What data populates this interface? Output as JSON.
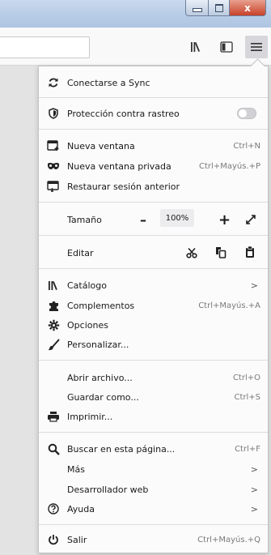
{
  "window": {
    "close_glyph": "x"
  },
  "menu": {
    "sync": {
      "label": "Conectarse a Sync"
    },
    "tracking": {
      "label": "Protección contra rastreo"
    },
    "new_window": {
      "label": "Nueva ventana",
      "shortcut": "Ctrl+N"
    },
    "private_window": {
      "label": "Nueva ventana privada",
      "shortcut": "Ctrl+Mayús.+P"
    },
    "restore_session": {
      "label": "Restaurar sesión anterior"
    },
    "zoom": {
      "label": "Tamaño",
      "minus": "–",
      "value": "100%",
      "plus": "+"
    },
    "edit": {
      "label": "Editar"
    },
    "library": {
      "label": "Catálogo",
      "chevron": ">"
    },
    "addons": {
      "label": "Complementos",
      "shortcut": "Ctrl+Mayús.+A"
    },
    "options": {
      "label": "Opciones"
    },
    "customize": {
      "label": "Personalizar..."
    },
    "open_file": {
      "label": "Abrir archivo...",
      "shortcut": "Ctrl+O"
    },
    "save_as": {
      "label": "Guardar como...",
      "shortcut": "Ctrl+S"
    },
    "print": {
      "label": "Imprimir..."
    },
    "find": {
      "label": "Buscar en esta página...",
      "shortcut": "Ctrl+F"
    },
    "more": {
      "label": "Más",
      "chevron": ">"
    },
    "web_dev": {
      "label": "Desarrollador web",
      "chevron": ">"
    },
    "help": {
      "label": "Ayuda",
      "chevron": ">"
    },
    "quit": {
      "label": "Salir",
      "shortcut": "Ctrl+Mayús.+Q"
    }
  },
  "icons": {
    "sync": "sync-icon",
    "tracking": "shield-icon",
    "new_window": "new-window-icon",
    "private_window": "private-mask-icon",
    "restore_session": "restore-icon",
    "fullscreen": "fullscreen-icon",
    "cut": "scissors-icon",
    "copy": "copy-icon",
    "paste": "clipboard-icon",
    "library": "library-icon",
    "addons": "puzzle-icon",
    "options": "gear-icon",
    "customize": "brush-icon",
    "print": "printer-icon",
    "find": "search-icon",
    "help": "help-icon",
    "quit": "power-icon"
  },
  "colors": {
    "titlebar": "#b9cde7",
    "close_button": "#c8412a",
    "panel_bg": "#fbfbfb",
    "toolbar_bg": "#f9f9fa"
  }
}
